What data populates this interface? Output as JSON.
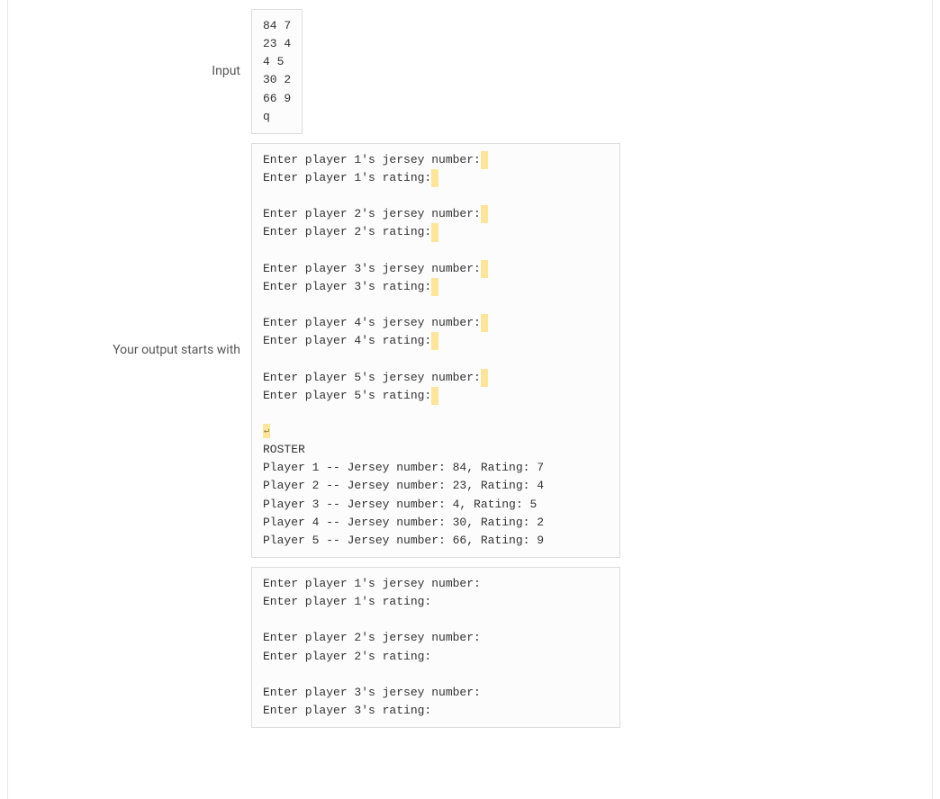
{
  "labels": {
    "input": "Input",
    "output_starts": "Your output starts with"
  },
  "input_box": {
    "lines": [
      "84 7",
      "23 4",
      "4 5",
      "30 2",
      "66 9",
      "q"
    ]
  },
  "output_highlighted": {
    "prompts": [
      {
        "jersey": "Enter player 1's jersey number:",
        "rating": "Enter player 1's rating:"
      },
      {
        "jersey": "Enter player 2's jersey number:",
        "rating": "Enter player 2's rating:"
      },
      {
        "jersey": "Enter player 3's jersey number:",
        "rating": "Enter player 3's rating:"
      },
      {
        "jersey": "Enter player 4's jersey number:",
        "rating": "Enter player 4's rating:"
      },
      {
        "jersey": "Enter player 5's jersey number:",
        "rating": "Enter player 5's rating:"
      }
    ],
    "roster_header": "ROSTER",
    "roster": [
      "Player 1 -- Jersey number: 84, Rating: 7",
      "Player 2 -- Jersey number: 23, Rating: 4",
      "Player 3 -- Jersey number: 4, Rating: 5",
      "Player 4 -- Jersey number: 30, Rating: 2",
      "Player 5 -- Jersey number: 66, Rating: 9"
    ]
  },
  "output_plain": {
    "prompts": [
      {
        "jersey": "Enter player 1's jersey number:",
        "rating": "Enter player 1's rating:"
      },
      {
        "jersey": "Enter player 2's jersey number:",
        "rating": "Enter player 2's rating:"
      },
      {
        "jersey": "Enter player 3's jersey number:",
        "rating": "Enter player 3's rating:"
      }
    ]
  }
}
